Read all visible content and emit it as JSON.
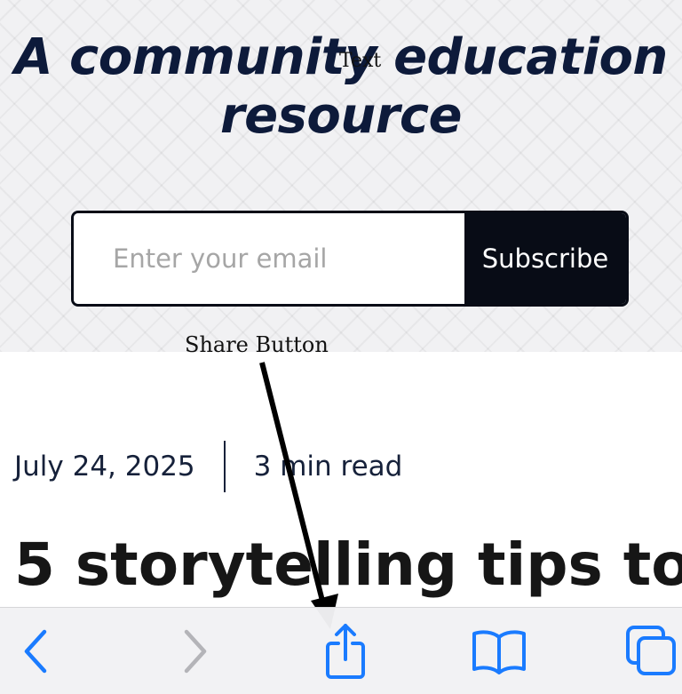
{
  "hero": {
    "title_line1": "A community education",
    "title_line2": "resource"
  },
  "subscribe": {
    "email_placeholder": "Enter your email",
    "button_label": "Subscribe"
  },
  "article": {
    "date": "July 24, 2025",
    "read_time": "3 min read",
    "title": "5 storytelling tips to"
  },
  "annotations": {
    "text_label": "Text",
    "share_label": "Share Button"
  },
  "toolbar": {
    "icons": [
      "back-icon",
      "forward-icon",
      "share-icon",
      "bookmarks-icon",
      "tabs-icon"
    ],
    "active_color": "#1a7bff",
    "disabled_color": "#b4b4b8"
  }
}
